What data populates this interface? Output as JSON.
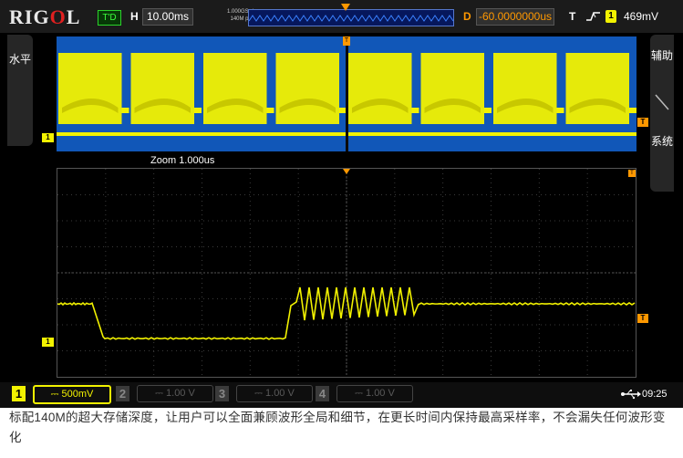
{
  "topbar": {
    "brand": "RIGOL",
    "trigger_status": "T'D",
    "horizontal_label": "H",
    "timebase": "10.00ms",
    "sample_rate": "1.000GSa/s",
    "memory_depth": "140M pts",
    "delay_label": "D",
    "delay": "-60.0000000us",
    "trigger_label": "T",
    "trigger_channel": "1",
    "trigger_level": "469mV"
  },
  "side_left": {
    "label": "水平"
  },
  "side_right": {
    "label_top": "辅助",
    "label_bottom": "系统"
  },
  "zoom": {
    "label": "Zoom",
    "timebase": "1.000us"
  },
  "markers": {
    "channel1": "1",
    "trigger": "T"
  },
  "channels": [
    {
      "num": "1",
      "scale": "500mV",
      "active": true,
      "color": "#f2f200"
    },
    {
      "num": "2",
      "scale": "1.00 V",
      "active": false,
      "color": "#00a0ff"
    },
    {
      "num": "3",
      "scale": "1.00 V",
      "active": false,
      "color": "#ff40ff"
    },
    {
      "num": "4",
      "scale": "1.00 V",
      "active": false,
      "color": "#00d0ff"
    }
  ],
  "status": {
    "time": "09:25",
    "usb_icon": "usb-icon"
  },
  "caption": "标配140M的超大存储深度，让用户可以全面兼顾波形全局和细节，在更长时间内保持最高采样率，不会漏失任何波形变化",
  "colors": {
    "trace": "#f2f200",
    "accent": "#ff9800",
    "overview_bg": "#1157b8"
  }
}
